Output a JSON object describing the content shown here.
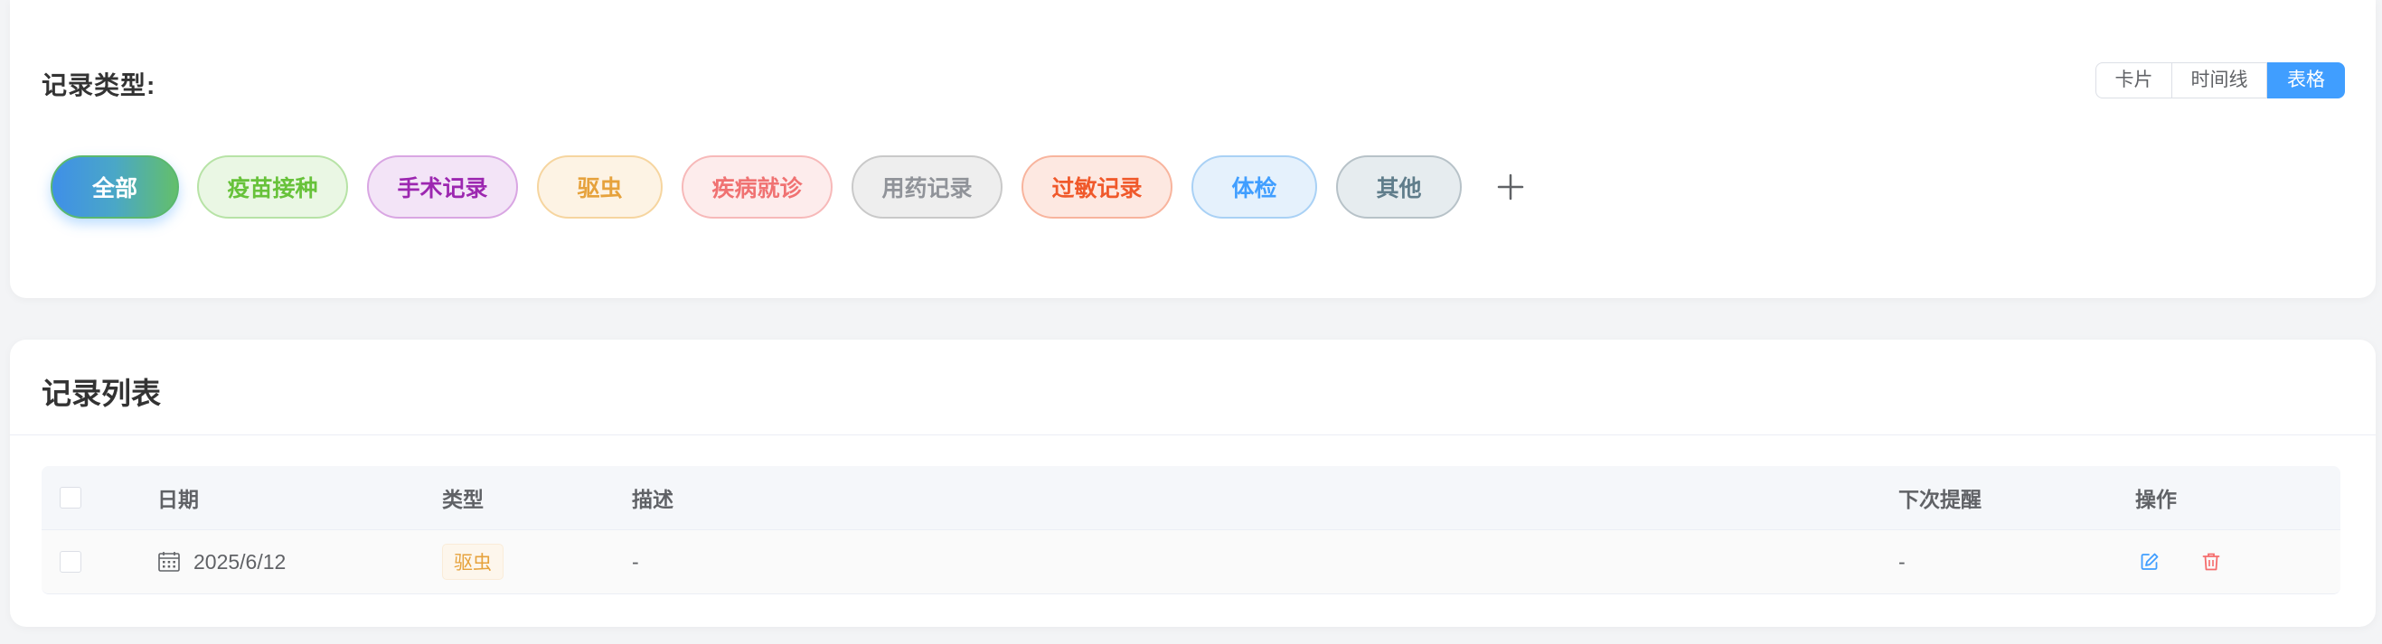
{
  "filter": {
    "label": "记录类型:",
    "view_options": [
      "卡片",
      "时间线",
      "表格"
    ],
    "active_view": "表格",
    "types": [
      {
        "label": "全部",
        "selected": true
      },
      {
        "label": "疫苗接种",
        "color": "#67c23a"
      },
      {
        "label": "手术记录",
        "color": "#9c27b0"
      },
      {
        "label": "驱虫",
        "color": "#e6a23c"
      },
      {
        "label": "疾病就诊",
        "color": "#f07272"
      },
      {
        "label": "用药记录",
        "color": "#909399"
      },
      {
        "label": "过敏记录",
        "color": "#f0592b"
      },
      {
        "label": "体检",
        "color": "#409eff"
      },
      {
        "label": "其他",
        "color": "#607d8b"
      }
    ],
    "add_icon": "plus-icon"
  },
  "list": {
    "title": "记录列表",
    "columns": {
      "date": "日期",
      "type": "类型",
      "description": "描述",
      "next_reminder": "下次提醒",
      "actions": "操作"
    },
    "rows": [
      {
        "date": "2025/6/12",
        "type": "驱虫",
        "description": "-",
        "next_reminder": "-",
        "icons": [
          "calendar-icon",
          "edit-icon",
          "delete-icon"
        ]
      }
    ]
  },
  "colors": {
    "primary": "#409eff",
    "danger": "#f56c6c",
    "warning": "#e6a23c"
  }
}
